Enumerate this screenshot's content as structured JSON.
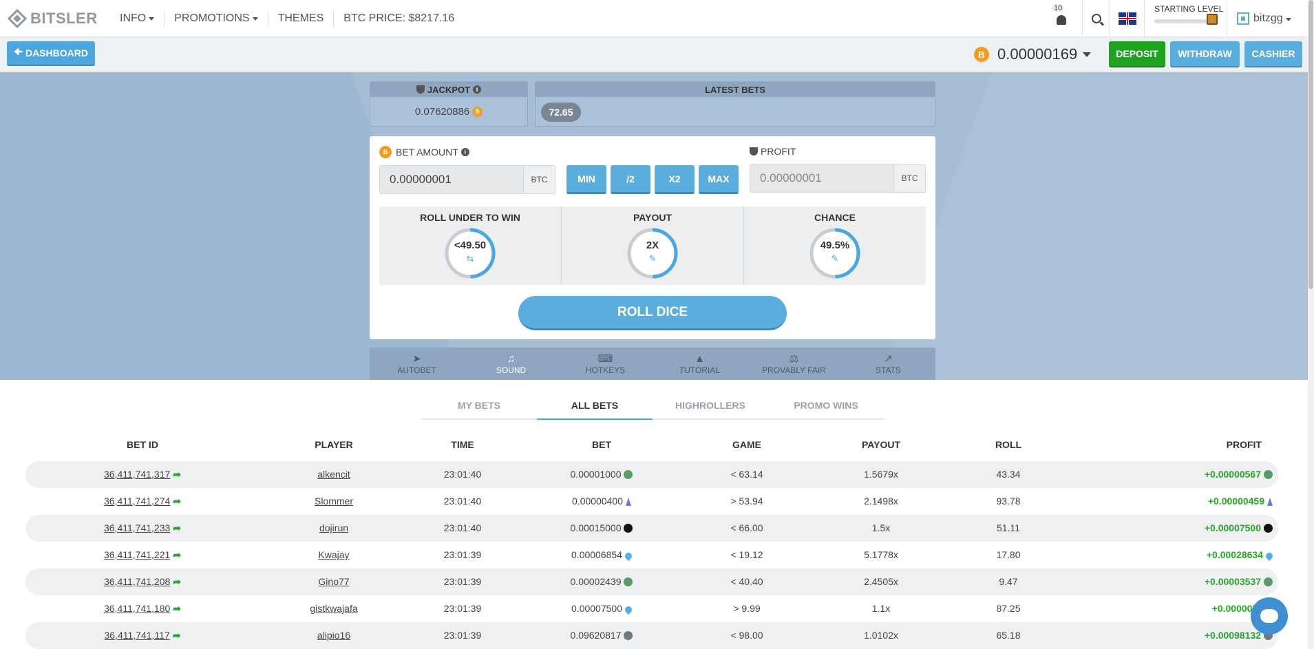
{
  "nav": {
    "logo": "BITSLER",
    "items": [
      "INFO",
      "PROMOTIONS",
      "THEMES"
    ],
    "btc_price": "BTC PRICE: $8217.16",
    "notifications": "10",
    "level_label": "STARTING LEVEL",
    "username": "bitzgg"
  },
  "subbar": {
    "dashboard": "DASHBOARD",
    "balance": "0.00000169",
    "deposit": "DEPOSIT",
    "withdraw": "WITHDRAW",
    "cashier": "CASHIER",
    "coin_symbol": "B"
  },
  "jackpot": {
    "title": "JACKPOT",
    "value": "0.07620886"
  },
  "latest_bets": {
    "title": "LATEST BETS",
    "last": "72.65"
  },
  "bet": {
    "amount_label": "BET AMOUNT",
    "amount_value": "0.00000001",
    "unit": "BTC",
    "min": "MIN",
    "half": "/2",
    "double": "X2",
    "max": "MAX",
    "profit_label": "PROFIT",
    "profit_value": "0.00000001"
  },
  "stats": {
    "roll_label": "ROLL UNDER TO WIN",
    "roll_value": "<49.50",
    "payout_label": "PAYOUT",
    "payout_value": "2X",
    "chance_label": "CHANCE",
    "chance_value": "49.5%"
  },
  "roll_button": "ROLL DICE",
  "toolbar": [
    "AUTOBET",
    "SOUND",
    "HOTKEYS",
    "TUTORIAL",
    "PROVABLY FAIR",
    "STATS"
  ],
  "tabs": [
    "MY BETS",
    "ALL BETS",
    "HIGHROLLERS",
    "PROMO WINS"
  ],
  "table": {
    "headers": [
      "BET ID",
      "PLAYER",
      "TIME",
      "BET",
      "GAME",
      "PAYOUT",
      "ROLL",
      "PROFIT"
    ],
    "rows": [
      {
        "id": "36,411,741,317",
        "player": "alkencit",
        "time": "23:01:40",
        "bet": "0.00001000",
        "coin": "green",
        "game": "< 63.14",
        "payout": "1.5679x",
        "roll": "43.34",
        "profit": "+0.00000567"
      },
      {
        "id": "36,411,741,274",
        "player": "Slommer",
        "time": "23:01:40",
        "bet": "0.00000400",
        "coin": "eth",
        "game": "> 53.94",
        "payout": "2.1498x",
        "roll": "93.78",
        "profit": "+0.00000459"
      },
      {
        "id": "36,411,741,233",
        "player": "dojirun",
        "time": "23:01:40",
        "bet": "0.00015000",
        "coin": "black",
        "game": "< 66.00",
        "payout": "1.5x",
        "roll": "51.11",
        "profit": "+0.00007500"
      },
      {
        "id": "36,411,741,221",
        "player": "Kwajay",
        "time": "23:01:39",
        "bet": "0.00006854",
        "coin": "drop",
        "game": "< 19.12",
        "payout": "5.1778x",
        "roll": "17.80",
        "profit": "+0.00028634"
      },
      {
        "id": "36,411,741,208",
        "player": "Gino77",
        "time": "23:01:39",
        "bet": "0.00002439",
        "coin": "green",
        "game": "< 40.40",
        "payout": "2.4505x",
        "roll": "9.47",
        "profit": "+0.00003537"
      },
      {
        "id": "36,411,741,180",
        "player": "gistkwajafa",
        "time": "23:01:39",
        "bet": "0.00007500",
        "coin": "drop",
        "game": "> 9.99",
        "payout": "1.1x",
        "roll": "87.25",
        "profit": "+0.0000075"
      },
      {
        "id": "36,411,741,117",
        "player": "alipio16",
        "time": "23:01:39",
        "bet": "0.09620817",
        "coin": "grey",
        "game": "< 98.00",
        "payout": "1.0102x",
        "roll": "65.18",
        "profit": "+0.00098132"
      }
    ]
  },
  "colors": {
    "accent": "#5aaede",
    "deposit": "#1ea31e",
    "profit": "#27a627",
    "btc": "#f39c22"
  }
}
